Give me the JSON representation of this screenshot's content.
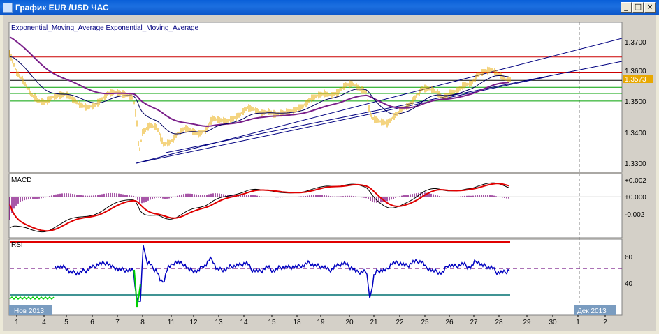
{
  "window": {
    "title": "График EUR /USD  ЧАС",
    "buttons": {
      "minimize": "_",
      "maximize": "□",
      "close": "×"
    }
  },
  "price_panel": {
    "indicator_label": "Exponential_Moving_Average Exponential_Moving_Average",
    "y_ticks": [
      "1.3700",
      "1.3600",
      "1.3500",
      "1.3400",
      "1.3300"
    ],
    "current_price": "1.3573"
  },
  "macd_panel": {
    "label": "MACD",
    "y_ticks": [
      "+0.002",
      "+0.000",
      "-0.002"
    ]
  },
  "rsi_panel": {
    "label": "RSI",
    "y_ticks": [
      "60",
      "40"
    ]
  },
  "x_axis": {
    "day_labels": [
      "1",
      "4",
      "5",
      "6",
      "7",
      "8",
      "11",
      "12",
      "13",
      "14",
      "15",
      "18",
      "19",
      "20",
      "21",
      "22",
      "25",
      "26",
      "27",
      "28",
      "29",
      "30",
      "1",
      "2"
    ],
    "month_labels": [
      "Нов 2013",
      "Дек 2013"
    ]
  },
  "colors": {
    "price_bars": "#e8a800",
    "ema_fast": "#000060",
    "ema_slow": "#7a1f8a",
    "resistance": "#cc0000",
    "support": "#00a000",
    "trendline": "#000080",
    "macd_signal": "#e00000",
    "macd_hist": "#8a1f8a",
    "rsi": "#0000c0",
    "rsi_oversold_segment": "#00d000",
    "rsi_mid": "#7a1f8a",
    "rsi_upper": "#e00000",
    "rsi_lower": "#007070",
    "price_marker": "#e8a800",
    "axis_label_bg": "#7a9cc0"
  },
  "chart_data": [
    {
      "type": "line",
      "title": "EUR/USD",
      "ylim": [
        1.33,
        1.37
      ],
      "horizontal_levels": {
        "resistance": [
          1.365,
          1.36
        ],
        "price": 1.3573,
        "support": [
          1.355,
          1.353,
          1.3505
        ]
      }
    },
    {
      "type": "line",
      "title": "MACD",
      "ylim": [
        -0.002,
        0.002
      ]
    },
    {
      "type": "line",
      "title": "RSI",
      "ylim": [
        40,
        60
      ],
      "levels": {
        "upper": 70,
        "middle": 50,
        "lower": 30
      }
    }
  ]
}
